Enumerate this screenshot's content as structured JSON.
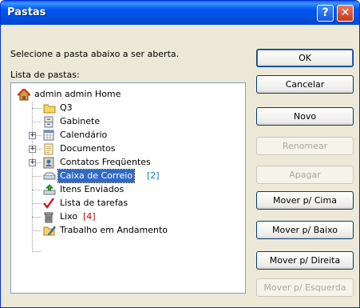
{
  "window": {
    "title": "Pastas",
    "help_glyph": "?",
    "close_glyph": "✕"
  },
  "prompt": "Selecione a pasta abaixo a ser aberta.",
  "list_label": "Lista de pastas:",
  "tree": {
    "root": "admin admin Home",
    "items": [
      {
        "label": "Q3",
        "icon": "folder-icon"
      },
      {
        "label": "Gabinete",
        "icon": "cabinet-icon"
      },
      {
        "label": "Calendário",
        "icon": "calendar-icon",
        "expandable": true
      },
      {
        "label": "Documentos",
        "icon": "documents-icon",
        "expandable": true
      },
      {
        "label": "Contatos Freqüentes",
        "icon": "contacts-icon",
        "expandable": true
      },
      {
        "label": "Caixa de Correio",
        "icon": "mailbox-icon",
        "count": "[2]",
        "selected": true
      },
      {
        "label": "Itens Enviados",
        "icon": "sent-items-icon"
      },
      {
        "label": "Lista de tarefas",
        "icon": "checklist-icon"
      },
      {
        "label": "Lixo",
        "icon": "trash-icon",
        "count": "[4]"
      },
      {
        "label": "Trabalho em Andamento",
        "icon": "work-in-progress-icon"
      }
    ]
  },
  "buttons": {
    "ok": "OK",
    "cancel": "Cancelar",
    "new": "Novo",
    "rename": "Renomear",
    "delete": "Apagar",
    "move_up": "Mover p/ Cima",
    "move_down": "Mover p/ Baixo",
    "move_right": "Mover p/ Direita",
    "move_left": "Mover p/ Esquerda"
  },
  "colors": {
    "titlebar": "#0054e3",
    "selection": "#316ac5",
    "count_blue": "#0b7fc4",
    "count_red": "#cc0000"
  }
}
